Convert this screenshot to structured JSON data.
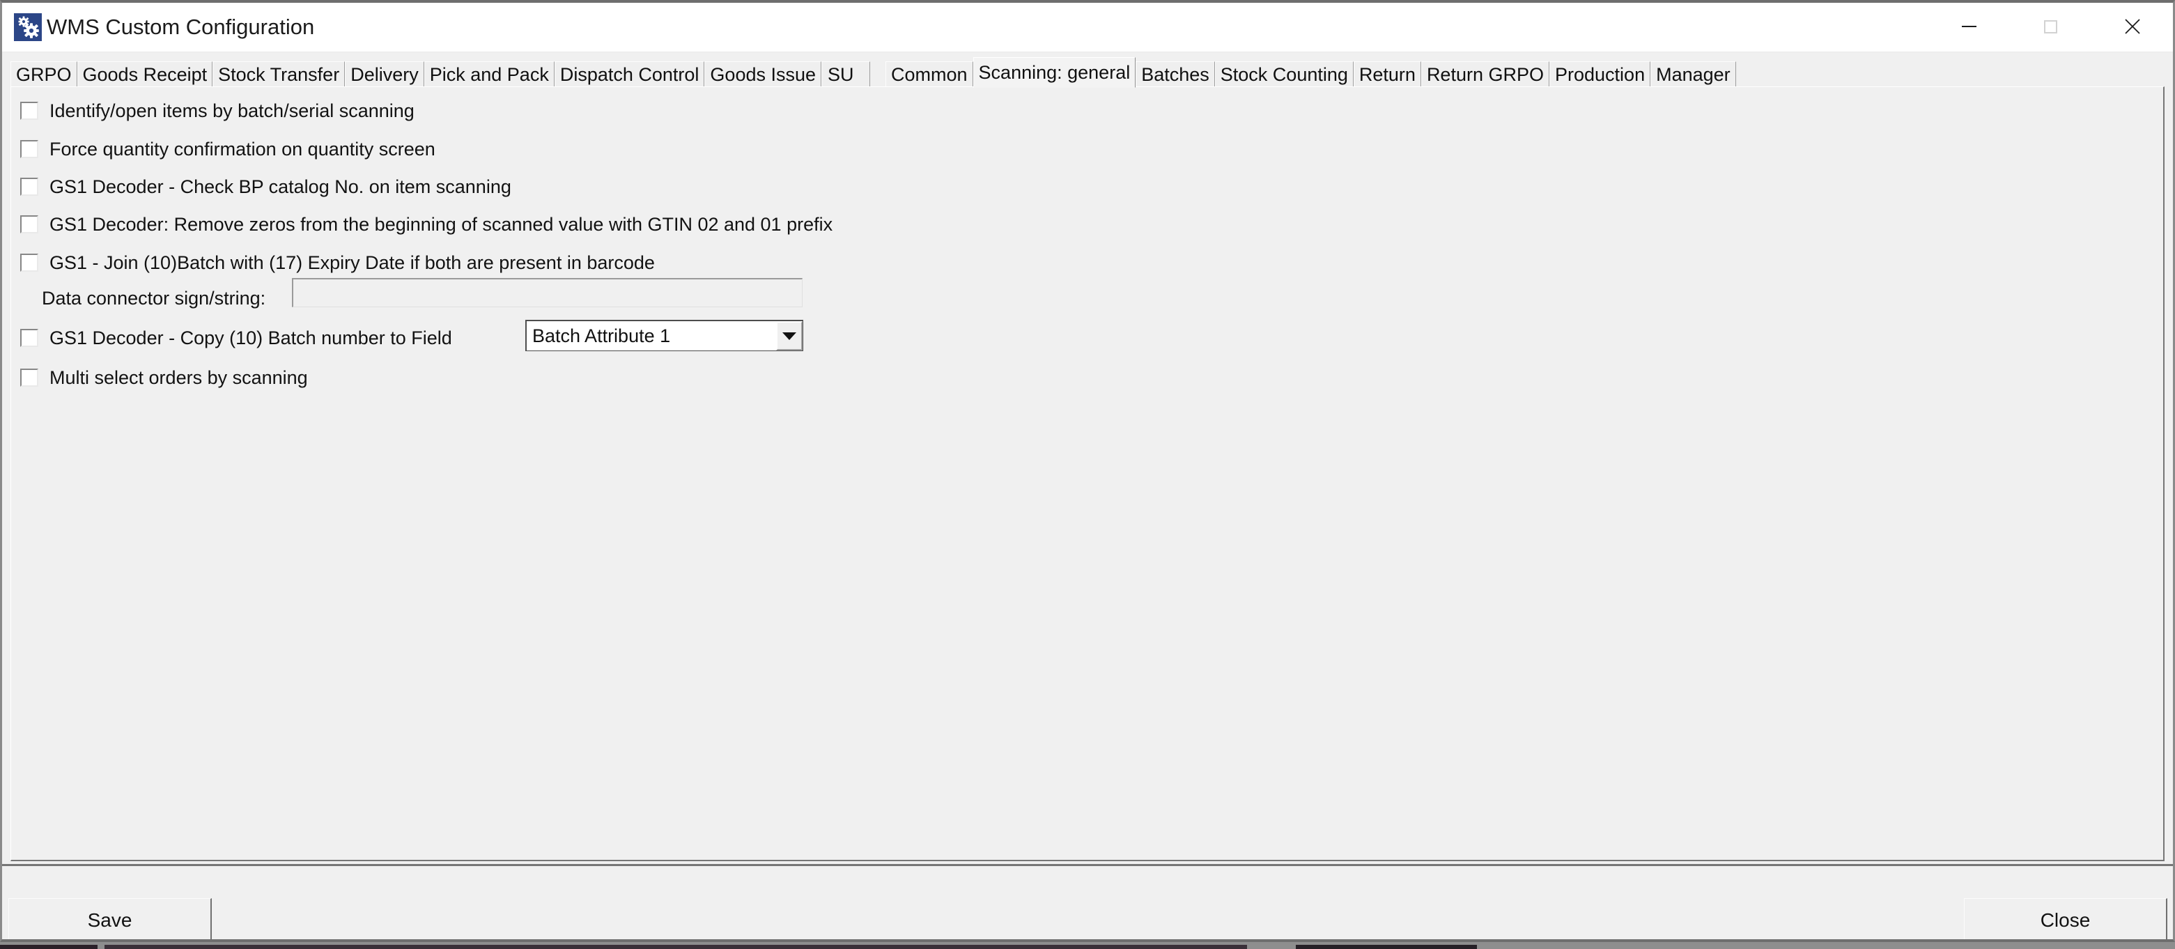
{
  "window": {
    "title": "WMS Custom Configuration",
    "icon": "gears-icon",
    "controls": {
      "minimize": "minimize-icon",
      "maximize": "maximize-icon",
      "close": "close-icon"
    }
  },
  "tabs": {
    "items": [
      {
        "label": "GRPO",
        "selected": false
      },
      {
        "label": "Goods Receipt",
        "selected": false
      },
      {
        "label": "Stock Transfer",
        "selected": false
      },
      {
        "label": "Delivery",
        "selected": false
      },
      {
        "label": "Pick and Pack",
        "selected": false
      },
      {
        "label": "Dispatch Control",
        "selected": false
      },
      {
        "label": "Goods Issue",
        "selected": false
      },
      {
        "label": "SU",
        "selected": false
      },
      {
        "label": "Common",
        "selected": false
      },
      {
        "label": "Scanning: general",
        "selected": true
      },
      {
        "label": "Batches",
        "selected": false
      },
      {
        "label": "Stock Counting",
        "selected": false
      },
      {
        "label": "Return",
        "selected": false
      },
      {
        "label": "Return GRPO",
        "selected": false
      },
      {
        "label": "Production",
        "selected": false
      },
      {
        "label": "Manager",
        "selected": false
      }
    ]
  },
  "settings": {
    "checkboxes": [
      {
        "label": "Identify/open items by batch/serial scanning",
        "checked": false
      },
      {
        "label": "Force quantity confirmation on quantity screen",
        "checked": false
      },
      {
        "label": "GS1 Decoder - Check BP catalog No. on item scanning",
        "checked": false
      },
      {
        "label": "GS1 Decoder: Remove zeros from the beginning of scanned value with GTIN 02 and 01 prefix",
        "checked": false
      },
      {
        "label": "GS1 - Join (10)Batch with (17) Expiry Date if both are present in barcode",
        "checked": false
      },
      {
        "label": "GS1 Decoder - Copy (10) Batch number to Field",
        "checked": false
      },
      {
        "label": "Multi select orders by scanning",
        "checked": false
      }
    ],
    "data_connector": {
      "label": "Data connector sign/string:",
      "value": "",
      "placeholder": ""
    },
    "batch_field_select": {
      "value": "Batch Attribute 1",
      "options": [
        "Batch Attribute 1"
      ]
    }
  },
  "footer": {
    "save_label": "Save",
    "close_label": "Close"
  },
  "colors": {
    "window_bg": "#f0f0f0",
    "titlebar_bg": "#ffffff",
    "icon_blue": "#2c4687",
    "text": "#121212",
    "border_dark": "#767676"
  }
}
